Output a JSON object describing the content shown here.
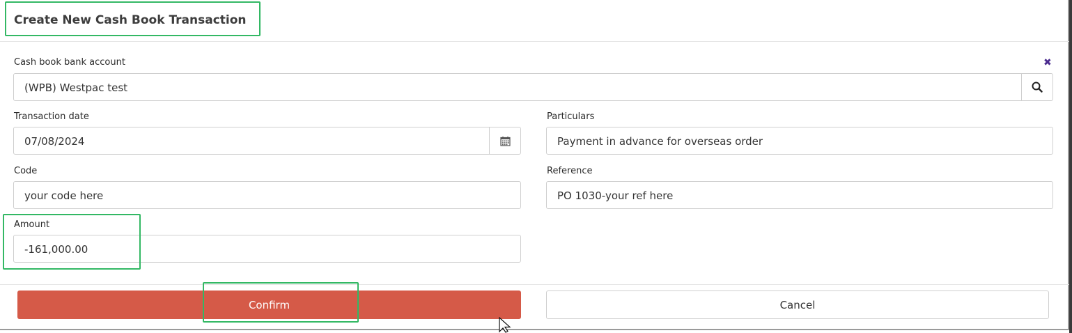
{
  "modal": {
    "title": "Create New Cash Book Transaction"
  },
  "form": {
    "bank_account": {
      "label": "Cash book bank account",
      "value": "(WPB) Westpac test",
      "clear_symbol": "✖"
    },
    "transaction_date": {
      "label": "Transaction date",
      "value": "07/08/2024"
    },
    "particulars": {
      "label": "Particulars",
      "value": "Payment in advance for overseas order"
    },
    "code": {
      "label": "Code",
      "value": "your code here"
    },
    "reference": {
      "label": "Reference",
      "value": "PO 1030-your ref here"
    },
    "amount": {
      "label": "Amount",
      "value": "-161,000.00"
    }
  },
  "buttons": {
    "confirm": "Confirm",
    "cancel": "Cancel"
  },
  "colors": {
    "confirm_bg": "#d55a48",
    "highlight": "#33b864",
    "clear_icon": "#4b2b8f"
  },
  "icons": {
    "search": "search-icon",
    "calendar": "calendar-icon",
    "clear": "close-icon"
  }
}
